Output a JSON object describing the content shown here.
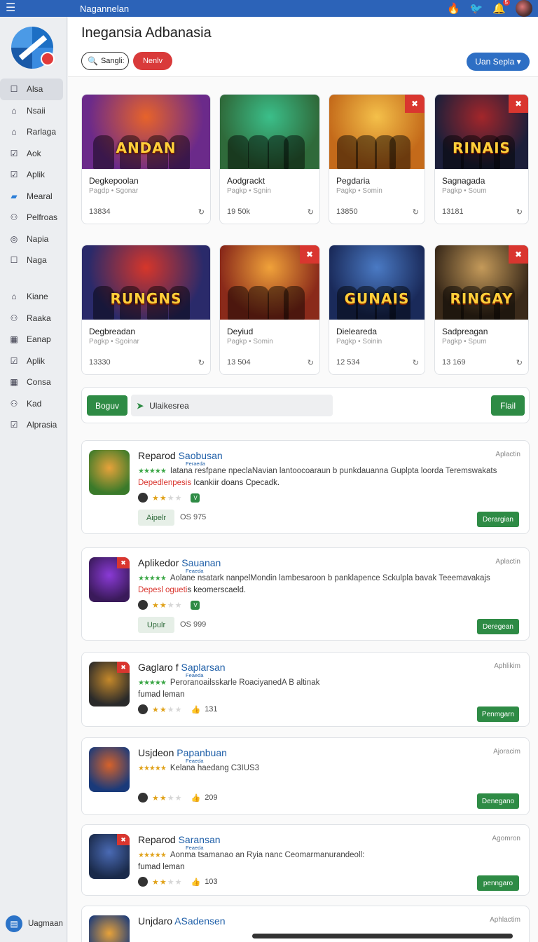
{
  "topbar": {
    "title": "Nagannelan",
    "notif_count": "5"
  },
  "sidebar": {
    "items": [
      {
        "label": "Alsa",
        "icon": "square-icon"
      },
      {
        "label": "Nsaii",
        "icon": "home-icon"
      },
      {
        "label": "Rarlaga",
        "icon": "house-icon"
      },
      {
        "label": "Aok",
        "icon": "check-square-icon"
      },
      {
        "label": "Aplik",
        "icon": "check-square-icon"
      },
      {
        "label": "Mearal",
        "icon": "folder-icon"
      },
      {
        "label": "Pelfroas",
        "icon": "users-icon"
      },
      {
        "label": "Napia",
        "icon": "target-icon"
      },
      {
        "label": "Naga",
        "icon": "square-icon"
      }
    ],
    "items2": [
      {
        "label": "Kiane",
        "icon": "home-icon"
      },
      {
        "label": "Raaka",
        "icon": "users-icon"
      },
      {
        "label": "Eanap",
        "icon": "grid-icon"
      },
      {
        "label": "Aplik",
        "icon": "check-square-icon"
      },
      {
        "label": "Consa",
        "icon": "grid-icon"
      },
      {
        "label": "Kad",
        "icon": "users-icon"
      },
      {
        "label": "Alprasia",
        "icon": "check-square-icon"
      }
    ],
    "footer_label": "Uagmaan"
  },
  "header": {
    "title": "Inegansia Adbanasia",
    "search_label": "Sangli:",
    "red_pill": "Nenlv",
    "blue_pill": "Uan Sepla ▾"
  },
  "games": [
    {
      "name": "Degkepoolan",
      "sub": "Pagdp • Sgonar",
      "count": "13834",
      "art": "ANDAN",
      "tag": false,
      "c1": "#6b2a8a",
      "c2": "#e7632a"
    },
    {
      "name": "Aodgrackt",
      "sub": "Pagkp • Sgnin",
      "count": "19 50k",
      "art": "",
      "tag": false,
      "c1": "#2f6a3a",
      "c2": "#3bbf8a"
    },
    {
      "name": "Pegdaria",
      "sub": "Pagkp • Somin",
      "count": "13850",
      "art": "",
      "tag": true,
      "c1": "#c46a1a",
      "c2": "#f4c04a"
    },
    {
      "name": "Sagnagada",
      "sub": "Pagkp • Soum",
      "count": "13181",
      "art": "RINAIS",
      "tag": true,
      "c1": "#1c1f3a",
      "c2": "#a3262a"
    },
    {
      "name": "Degbreadan",
      "sub": "Pagkp • Sgoinar",
      "count": "13330",
      "art": "RUNGNS",
      "tag": false,
      "c1": "#2a2a6a",
      "c2": "#d6362a"
    },
    {
      "name": "Deyiud",
      "sub": "Pagkp • Somin",
      "count": "13 504",
      "art": "",
      "tag": true,
      "c1": "#8a2a1a",
      "c2": "#f0a23a"
    },
    {
      "name": "Dieleareda",
      "sub": "Pagkp • Soinin",
      "count": "12 534",
      "art": "GUNAIS",
      "tag": false,
      "c1": "#1a2a5a",
      "c2": "#4a7ac4"
    },
    {
      "name": "Sadpreagan",
      "sub": "Pagkp • Spum",
      "count": "13 169",
      "art": "RINGAY",
      "tag": true,
      "c1": "#3a2a1a",
      "c2": "#c49a5a"
    }
  ],
  "filter": {
    "left_btn": "Boguv",
    "field": "Ulaikesrea",
    "right_btn": "Flail"
  },
  "apps": [
    {
      "title": "Reparod",
      "highlight": "Saobusan",
      "small": "Feraeda",
      "category": "Aplactin",
      "desc": "Iatana resfpane npeclaNavian lantoocoaraun b punkdauanna Guplpta loorda Teremswakats",
      "line2_red": "Depedlenpesis",
      "line2_rest": " Icankiir doans Cpecadk.",
      "rating": 2,
      "meta_icon": "v",
      "meta_count": "",
      "chip": "Aipelr",
      "version": "OS 975",
      "action": "Derargian",
      "c1": "#3a7a2a",
      "c2": "#e7a23a",
      "tag": false
    },
    {
      "title": "Aplikedor",
      "highlight": "Sauanan",
      "small": "Feaeda",
      "category": "Aplactin",
      "desc": "Aolane nsatark nanpelMondin lambesaroon b panklapence Sckulpla bavak Teeemavakajs",
      "line2_red": "Depesl ogueti",
      "line2_rest": "s keomerscaeld.",
      "rating": 2,
      "meta_icon": "v",
      "meta_count": "",
      "chip": "Upulr",
      "version": "OS 999",
      "action": "Deregean",
      "c1": "#3a1a5a",
      "c2": "#8a3ad6",
      "tag": true
    },
    {
      "title": "Gaglaro f",
      "highlight": "Saplarsan",
      "small": "Feaeda",
      "category": "Aphlikim",
      "desc": "Peroranoailsskarle RoaciyanedA B altinak",
      "line2_red": "",
      "line2_rest": "fumad leman",
      "rating": 2,
      "meta_icon": "thumb",
      "meta_count": "131",
      "chip": "",
      "version": "",
      "action": "Penmgarn",
      "c1": "#2a2a2a",
      "c2": "#c4882a",
      "tag": true
    },
    {
      "title": "Usjdeon",
      "highlight": "Papanbuan",
      "small": "Feaeda",
      "category": "Ajoracim",
      "desc": "Kelana haedang C3IUS3",
      "line2_red": "",
      "line2_rest": "",
      "rating": 2,
      "meta_icon": "thumb",
      "meta_count": "209",
      "chip": "",
      "version": "",
      "action": "Denegano",
      "c1": "#1a3a7a",
      "c2": "#d6622a",
      "tag": false
    },
    {
      "title": "Reparod",
      "highlight": "Saransan",
      "small": "Feaeda",
      "category": "Agomron",
      "desc": "Aonma tsamanao an Ryia nanc Ceomarmanurandeoll:",
      "line2_red": "",
      "line2_rest": "fumad leman",
      "rating": 2,
      "meta_icon": "thumb",
      "meta_count": "103",
      "chip": "",
      "version": "",
      "action": "penngaro",
      "c1": "#1a2a4a",
      "c2": "#4a6ab4",
      "tag": true
    },
    {
      "title": "Unjdaro",
      "highlight": "ASadensen",
      "small": "",
      "category": "Aphlactim",
      "desc": "",
      "line2_red": "",
      "line2_rest": "",
      "rating": 0,
      "meta_icon": "",
      "meta_count": "",
      "chip": "",
      "version": "",
      "action": "",
      "c1": "#1a3a7a",
      "c2": "#e7a23a",
      "tag": false
    }
  ]
}
